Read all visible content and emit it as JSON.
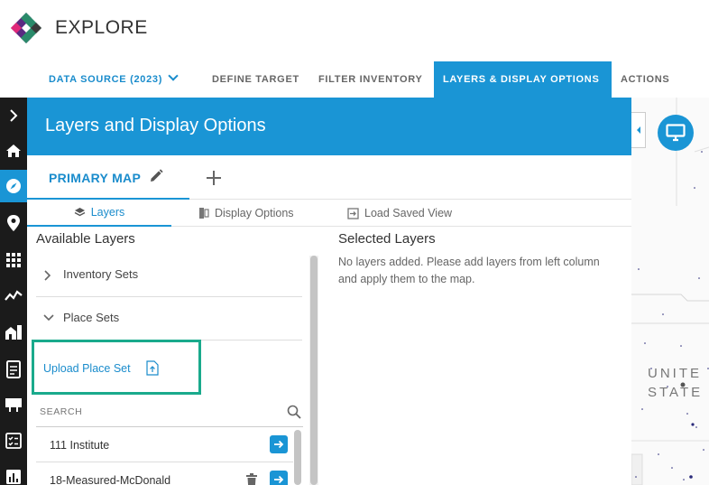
{
  "app": {
    "title": "EXPLORE"
  },
  "nav": {
    "data_source": "DATA SOURCE (2023)",
    "define_target": "DEFINE TARGET",
    "filter_inventory": "FILTER INVENTORY",
    "layers_display": "LAYERS & DISPLAY OPTIONS",
    "actions": "ACTIONS"
  },
  "rail_icons": [
    "expand-icon",
    "home-icon",
    "compass-icon",
    "location-pin-icon",
    "grid-icon",
    "trend-icon",
    "buildings-icon",
    "report-icon",
    "billboard-icon",
    "checklist-icon",
    "bar-chart-icon"
  ],
  "panel": {
    "title": "Layers and Display Options",
    "map_tab": "PRIMARY MAP",
    "subtabs": {
      "layers": "Layers",
      "display": "Display Options",
      "load": "Load Saved View"
    }
  },
  "available": {
    "title": "Available Layers",
    "inventory_sets": "Inventory Sets",
    "place_sets": "Place Sets",
    "upload": "Upload Place Set",
    "search_placeholder": "SEARCH",
    "items": [
      {
        "name": "111 Institute"
      },
      {
        "name": "18-Measured-McDonald"
      }
    ]
  },
  "selected": {
    "title": "Selected Layers",
    "empty": "No layers added. Please add layers from left column and apply them to the map."
  },
  "map": {
    "label_line1": "UNITE",
    "label_line2": "STATE"
  },
  "colors": {
    "accent": "#1a95d5",
    "highlight_border": "#1aaa8c",
    "rail": "#1b1b1b"
  }
}
